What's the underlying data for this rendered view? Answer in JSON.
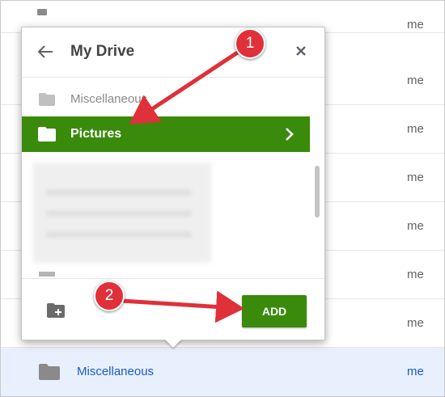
{
  "background_list": {
    "owner": "me",
    "selected_item": {
      "name": "Miscellaneous",
      "owner": "me"
    }
  },
  "dialog": {
    "title": "My Drive",
    "items": [
      {
        "label": "Miscellaneous"
      },
      {
        "label": "Pictures"
      }
    ],
    "add_label": "ADD"
  },
  "annotations": {
    "step1": "1",
    "step2": "2"
  },
  "colors": {
    "accent_green": "#3a8a0c",
    "annotation_red": "#e0303a",
    "selection_blue": "#e8f0fe"
  }
}
